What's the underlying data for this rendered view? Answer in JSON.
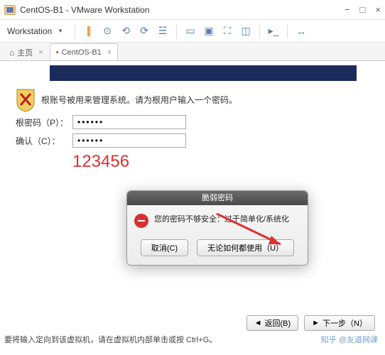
{
  "window": {
    "title": "CentOS-B1 - VMware Workstation"
  },
  "menu": {
    "workstation": "Workstation"
  },
  "tabs": {
    "home": "主页",
    "vm": "CentOS-B1"
  },
  "installer": {
    "instruction": "根账号被用来管理系统。请为根用户输入一个密码。",
    "pw_label": "根密码（P）：",
    "confirm_label": "确认（C）：",
    "pw_value": "••••••",
    "confirm_value": "••••••",
    "annotation": "123456"
  },
  "dialog": {
    "title": "脆弱密码",
    "message": "您的密码不够安全：过于简单化/系统化",
    "cancel": "取消(C)",
    "use_anyway": "无论如何都使用（U）"
  },
  "nav": {
    "back": "返回(B)",
    "next": "下一步（N）"
  },
  "status": "要将输入定向到该虚拟机，请在虚拟机内部单击或按 Ctrl+G。",
  "watermark": "知乎 @友道网课"
}
